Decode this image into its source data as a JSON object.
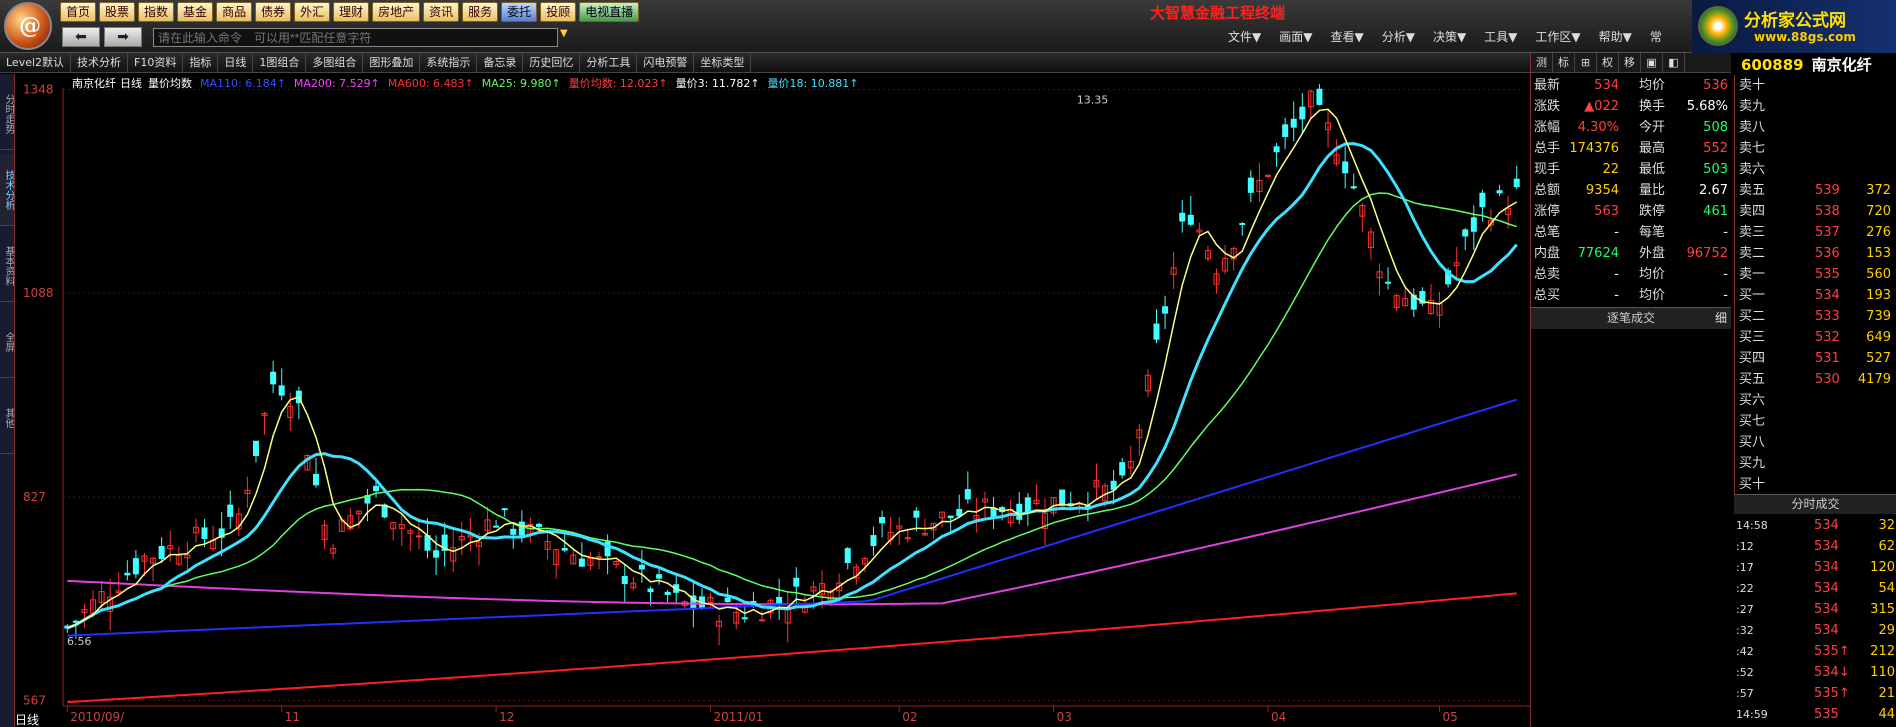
{
  "menu": {
    "items": [
      {
        "label": "首页"
      },
      {
        "label": "股票"
      },
      {
        "label": "指数"
      },
      {
        "label": "基金"
      },
      {
        "label": "商品"
      },
      {
        "label": "债券"
      },
      {
        "label": "外汇"
      },
      {
        "label": "理财"
      },
      {
        "label": "房地产"
      },
      {
        "label": "资讯"
      },
      {
        "label": "服务"
      },
      {
        "label": "委托",
        "style": "blue"
      },
      {
        "label": "投顾"
      },
      {
        "label": "电视直播",
        "style": "green"
      }
    ]
  },
  "app_title": "大智慧金融工程终端",
  "nav": {
    "back": "⬅",
    "forward": "➡"
  },
  "command": {
    "placeholder": "请在此输入命令　可以用**匹配任意字符",
    "drop": "▼"
  },
  "right_menu": [
    "文件▼",
    "画面▼",
    "查看▼",
    "分析▼",
    "决策▼",
    "工具▼",
    "工作区▼",
    "帮助▼",
    "常"
  ],
  "brand": {
    "title": "分析家公式网",
    "url": "www.88gs.com"
  },
  "toolbar": [
    "Level2默认",
    "技术分析",
    "F10资料",
    "指标",
    "日线",
    "1图组合",
    "多图组合",
    "图形叠加",
    "系统指示",
    "备忘录",
    "历史回忆",
    "分析工具",
    "闪电预警",
    "坐标类型"
  ],
  "left_tabs": [
    {
      "label": "分时走势",
      "active": false
    },
    {
      "label": "技术分析",
      "active": true
    },
    {
      "label": "基本资料",
      "active": false
    },
    {
      "label": "全屏",
      "active": false
    },
    {
      "label": "其他",
      "active": false
    }
  ],
  "chart_info": {
    "stock": "南京化纤",
    "period": "日线",
    "indicator": "量价均数",
    "items": [
      {
        "text": "MA110: 6.184↑",
        "color": "#3050ff"
      },
      {
        "text": "MA200: 7.529↑",
        "color": "#ff40ff"
      },
      {
        "text": "MA600: 6.483↑",
        "color": "#ff3030"
      },
      {
        "text": "MA25: 9.980↑",
        "color": "#60ff60"
      },
      {
        "text": "量价均数: 12.023↑",
        "color": "#ff4040"
      },
      {
        "text": "量价3: 11.782↑",
        "color": "#ffffff"
      },
      {
        "text": "量价18: 10.881↑",
        "color": "#40e0ff"
      }
    ]
  },
  "chart_data": {
    "type": "candlestick",
    "y_ticks": [
      5.67,
      8.27,
      10.88,
      13.48
    ],
    "y_tick_labels": [
      "567",
      "827",
      "1088",
      "1348"
    ],
    "x_labels": [
      {
        "label": "2010/09/",
        "x_index": 0
      },
      {
        "label": "11",
        "x_index": 25
      },
      {
        "label": "12",
        "x_index": 50
      },
      {
        "label": "2011/01",
        "x_index": 75
      },
      {
        "label": "02",
        "x_index": 97
      },
      {
        "label": "03",
        "x_index": 115
      },
      {
        "label": "04",
        "x_index": 140
      },
      {
        "label": "05",
        "x_index": 160
      }
    ],
    "ylim": [
      5.6,
      13.5
    ],
    "high_label": "13.35",
    "low_label": "6.56",
    "bottom_label": "日线"
  },
  "stock": {
    "code": "600889",
    "name": "南京化纤"
  },
  "right_tabs": [
    "测",
    "标",
    "⊞",
    "权",
    "移",
    "▣",
    "◧"
  ],
  "quote": [
    {
      "l": "最新",
      "v": "534",
      "vc": "red",
      "l2": "均价",
      "v2": "536",
      "v2c": "red"
    },
    {
      "l": "涨跌",
      "v": "▲022",
      "vc": "red",
      "l2": "换手",
      "v2": "5.68%",
      "v2c": "white"
    },
    {
      "l": "涨幅",
      "v": "4.30%",
      "vc": "red",
      "l2": "今开",
      "v2": "508",
      "v2c": "green"
    },
    {
      "l": "总手",
      "v": "174376",
      "vc": "yel",
      "l2": "最高",
      "v2": "552",
      "v2c": "red"
    },
    {
      "l": "现手",
      "v": "22",
      "vc": "yel",
      "l2": "最低",
      "v2": "503",
      "v2c": "green"
    },
    {
      "l": "总额",
      "v": "9354",
      "vc": "yel",
      "l2": "量比",
      "v2": "2.67",
      "v2c": "white"
    },
    {
      "l": "涨停",
      "v": "563",
      "vc": "red",
      "l2": "跌停",
      "v2": "461",
      "v2c": "green"
    },
    {
      "l": "总笔",
      "v": "-",
      "vc": "white",
      "l2": "每笔",
      "v2": "-",
      "v2c": "white"
    },
    {
      "l": "内盘",
      "v": "77624",
      "vc": "green",
      "l2": "外盘",
      "v2": "96752",
      "v2c": "red"
    },
    {
      "l": "总卖",
      "v": "-",
      "vc": "white",
      "l2": "均价",
      "v2": "-",
      "v2c": "white"
    },
    {
      "l": "总买",
      "v": "-",
      "vc": "white",
      "l2": "均价",
      "v2": "-",
      "v2c": "white"
    }
  ],
  "tick_button": {
    "label": "逐笔成交",
    "extra": "细"
  },
  "order_book": [
    {
      "l": "卖十",
      "p": "",
      "pc": "red",
      "v": ""
    },
    {
      "l": "卖九",
      "p": "",
      "pc": "red",
      "v": ""
    },
    {
      "l": "卖八",
      "p": "",
      "pc": "red",
      "v": ""
    },
    {
      "l": "卖七",
      "p": "",
      "pc": "red",
      "v": ""
    },
    {
      "l": "卖六",
      "p": "",
      "pc": "red",
      "v": ""
    },
    {
      "l": "卖五",
      "p": "539",
      "pc": "red",
      "v": "372"
    },
    {
      "l": "卖四",
      "p": "538",
      "pc": "red",
      "v": "720"
    },
    {
      "l": "卖三",
      "p": "537",
      "pc": "red",
      "v": "276"
    },
    {
      "l": "卖二",
      "p": "536",
      "pc": "red",
      "v": "153"
    },
    {
      "l": "卖一",
      "p": "535",
      "pc": "red",
      "v": "560"
    },
    {
      "l": "买一",
      "p": "534",
      "pc": "red",
      "v": "193"
    },
    {
      "l": "买二",
      "p": "533",
      "pc": "red",
      "v": "739"
    },
    {
      "l": "买三",
      "p": "532",
      "pc": "red",
      "v": "649"
    },
    {
      "l": "买四",
      "p": "531",
      "pc": "red",
      "v": "527"
    },
    {
      "l": "买五",
      "p": "530",
      "pc": "red",
      "v": "4179"
    },
    {
      "l": "买六",
      "p": "",
      "pc": "red",
      "v": ""
    },
    {
      "l": "买七",
      "p": "",
      "pc": "red",
      "v": ""
    },
    {
      "l": "买八",
      "p": "",
      "pc": "red",
      "v": ""
    },
    {
      "l": "买九",
      "p": "",
      "pc": "red",
      "v": ""
    },
    {
      "l": "买十",
      "p": "",
      "pc": "red",
      "v": ""
    }
  ],
  "timesales_header": "分时成交",
  "timesales": [
    {
      "t": "14:58",
      "p": "534",
      "v": "32"
    },
    {
      "t": ":12",
      "p": "534",
      "v": "62"
    },
    {
      "t": ":17",
      "p": "534",
      "v": "120"
    },
    {
      "t": ":22",
      "p": "534",
      "v": "54"
    },
    {
      "t": ":27",
      "p": "534",
      "v": "315"
    },
    {
      "t": ":32",
      "p": "534",
      "v": "29"
    },
    {
      "t": ":42",
      "p": "535↑",
      "v": "212"
    },
    {
      "t": ":52",
      "p": "534↓",
      "v": "110"
    },
    {
      "t": ":57",
      "p": "535↑",
      "v": "21"
    },
    {
      "t": "14:59",
      "p": "535",
      "v": "44"
    }
  ]
}
